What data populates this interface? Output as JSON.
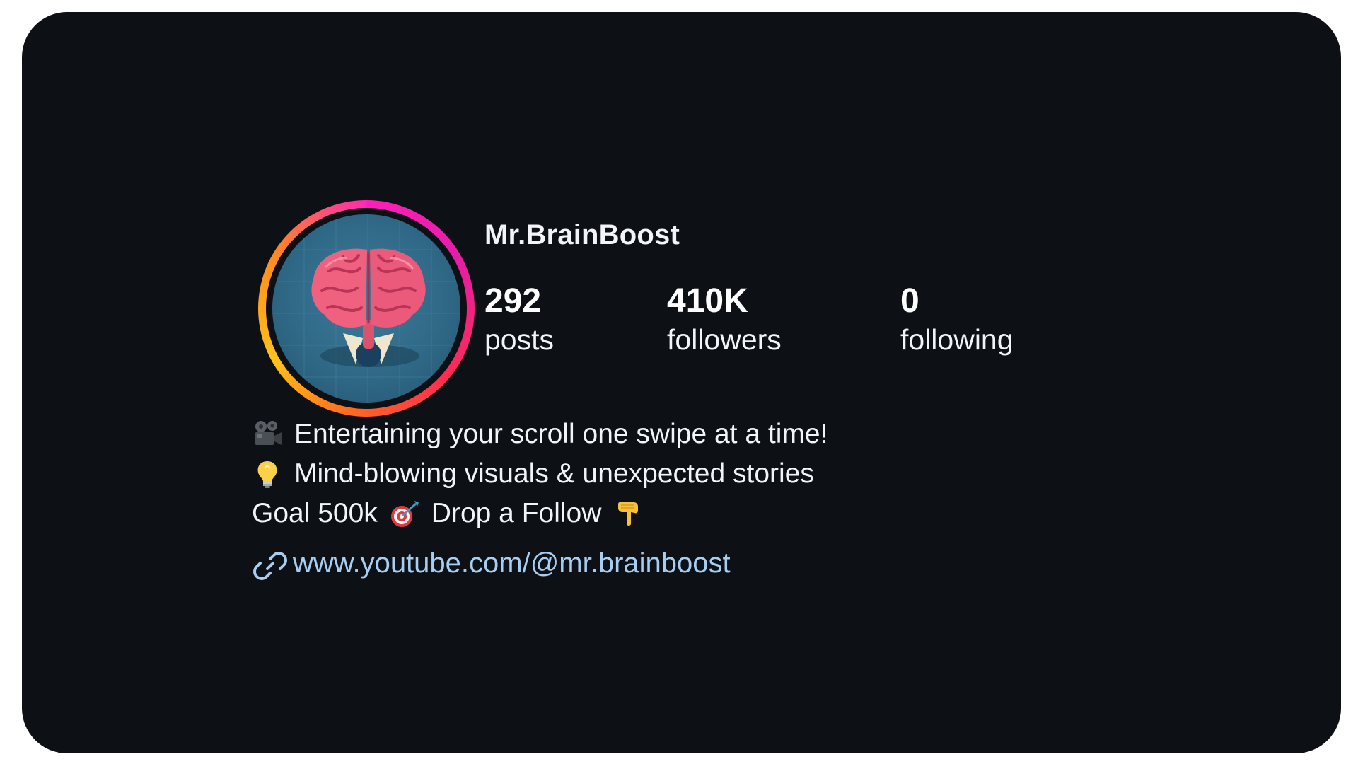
{
  "profile": {
    "username": "Mr.BrainBoost",
    "stats": {
      "posts": {
        "value": "292",
        "label": "posts"
      },
      "followers": {
        "value": "410K",
        "label": "followers"
      },
      "following": {
        "value": "0",
        "label": "following"
      }
    },
    "bio": {
      "line1": {
        "icon": "movie-camera-icon",
        "text": "Entertaining your scroll one swipe at a time!"
      },
      "line2": {
        "icon": "light-bulb-icon",
        "text": "Mind-blowing visuals & unexpected stories"
      },
      "line3": {
        "before": "Goal 500k",
        "icon": "target-icon",
        "after": "Drop a Follow",
        "end_icon": "pointing-down-icon"
      }
    },
    "link": {
      "icon": "link-icon",
      "url": "www.youtube.com/@mr.brainboost"
    },
    "avatar": {
      "icon": "brain-avatar-icon"
    }
  },
  "colors": {
    "card_bg": "#0d1015",
    "text": "#f2f4f7",
    "link": "#a7cdf0",
    "ring_start": "#ff1fb8",
    "ring_end": "#ffc21a"
  }
}
